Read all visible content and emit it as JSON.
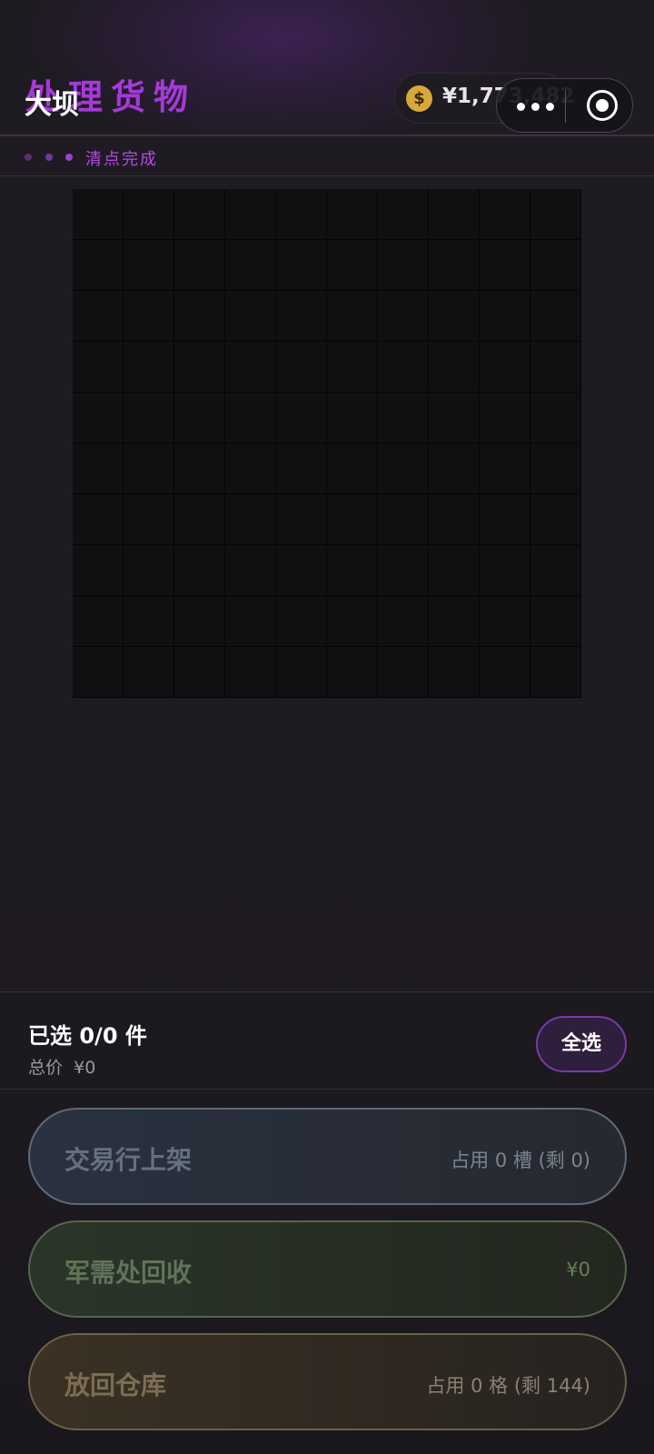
{
  "header": {
    "title": "处理货物",
    "map_name": "大坝",
    "money": "¥1,773,482",
    "coin_icon": "$"
  },
  "status": {
    "text": "清点完成",
    "dot_colors": [
      "#5c3070",
      "#74369a",
      "#9a44cc"
    ]
  },
  "grid": {
    "columns": 10,
    "rows": 10
  },
  "selection": {
    "count_label": "已选 0/0 件",
    "price_label": "总价",
    "price_value": "¥0",
    "select_all": "全选"
  },
  "actions": {
    "market": {
      "label": "交易行上架",
      "info": "占用 0 槽 (剩 0)"
    },
    "recycle": {
      "label": "军需处回收",
      "info": "¥0"
    },
    "return": {
      "label": "放回仓库",
      "info": "占用 0 格 (剩 144)"
    }
  }
}
